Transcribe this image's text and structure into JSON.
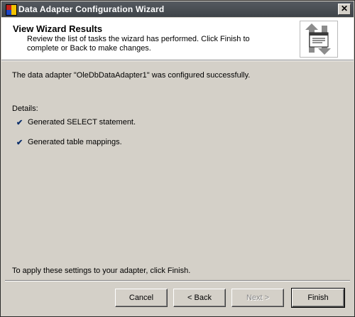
{
  "window": {
    "title": "Data Adapter Configuration Wizard",
    "close_glyph": "✕"
  },
  "header": {
    "title": "View Wizard Results",
    "description": "Review the list of tasks the wizard has performed. Click Finish to complete or Back to make changes."
  },
  "body": {
    "status_message": "The data adapter \"OleDbDataAdapter1\" was configured successfully.",
    "details_label": "Details:",
    "details": [
      {
        "text": "Generated SELECT statement.",
        "icon": "checkmark-icon"
      },
      {
        "text": "Generated table mappings.",
        "icon": "checkmark-icon"
      }
    ],
    "check_glyph": "✔",
    "footer_note": "To apply these settings to your adapter, click Finish."
  },
  "buttons": {
    "cancel": "Cancel",
    "back": "< Back",
    "next": "Next >",
    "finish": "Finish"
  },
  "colors": {
    "titlebar": "#4a4f54",
    "dialog_bg": "#d4d0c8",
    "header_bg": "#ffffff",
    "icon_arrow": "#8c8c8c"
  }
}
